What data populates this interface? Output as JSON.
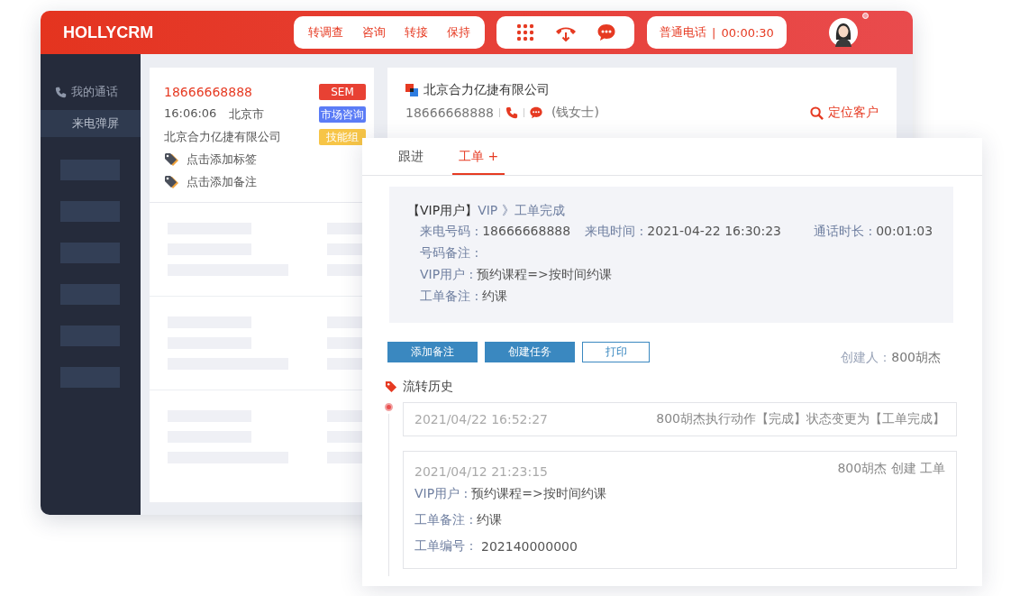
{
  "header": {
    "logo": "HOLLYCRM",
    "actions": [
      "转调查",
      "咨询",
      "转接",
      "保持"
    ],
    "call_tools": [
      {
        "kind": "dialpad"
      },
      {
        "kind": "hangup"
      },
      {
        "kind": "chat"
      }
    ],
    "line_type": "普通电话",
    "separator": "|",
    "timer": "00:00:30"
  },
  "sidebar": {
    "section": "我的通话",
    "items": [
      {
        "label": "来电弹屏",
        "selected": true
      }
    ]
  },
  "call_card": {
    "phone": "18666668888",
    "time": "16:06:06",
    "city": "北京市",
    "company": "北京合力亿捷有限公司",
    "tags": [
      {
        "label": "SEM",
        "color": "#e84133"
      },
      {
        "label": "市场咨询",
        "color": "#5b7cf6"
      },
      {
        "label": "技能组",
        "color": "#f7c547"
      }
    ],
    "links": [
      "点击添加标签",
      "点击添加备注"
    ]
  },
  "customer": {
    "company": "北京合力亿捷有限公司",
    "phone": "18666668888",
    "contact": "(钱女士)",
    "locate": "定位客户"
  },
  "ticket": {
    "tabs": [
      {
        "label": "跟进",
        "selected": false
      },
      {
        "label": "工单 +",
        "selected": true
      }
    ],
    "heading_tag": "【VIP用户】",
    "heading": "VIP 》工单完成",
    "field_rows": [
      [
        {
          "label": "来电号码 :",
          "value": "18666668888"
        },
        {
          "label": "来电时间 :",
          "value": "2021-04-22 16:30:23"
        },
        {
          "label": "通话时长 :",
          "value": "00:01:03"
        }
      ],
      [
        {
          "label": "号码备注 :"
        }
      ],
      [
        {
          "label": "VIP用户 :",
          "value": "预约课程=>按时间约课"
        }
      ],
      [
        {
          "label": "工单备注 :",
          "value": "约课"
        }
      ]
    ],
    "buttons": [
      {
        "label": "添加备注",
        "kind": "primary"
      },
      {
        "label": "创建任务",
        "kind": "primary"
      },
      {
        "label": "打印",
        "kind": "outline"
      }
    ],
    "creator_label": "创建人：",
    "creator": "800胡杰"
  },
  "history": {
    "title": "流转历史",
    "entries": [
      {
        "time": "2021/04/22 16:52:27",
        "action": "800胡杰执行动作【完成】状态变更为【工单完成】"
      },
      {
        "time": "2021/04/12 21:23:15",
        "action": "800胡杰 创建 工单",
        "fields": [
          {
            "label": "VIP用户 :",
            "value": "预约课程=>按时间约课"
          },
          {
            "label": "工单备注 :",
            "value": "约课"
          },
          {
            "label": "工单编号：",
            "value": "202140000000"
          }
        ]
      }
    ]
  }
}
